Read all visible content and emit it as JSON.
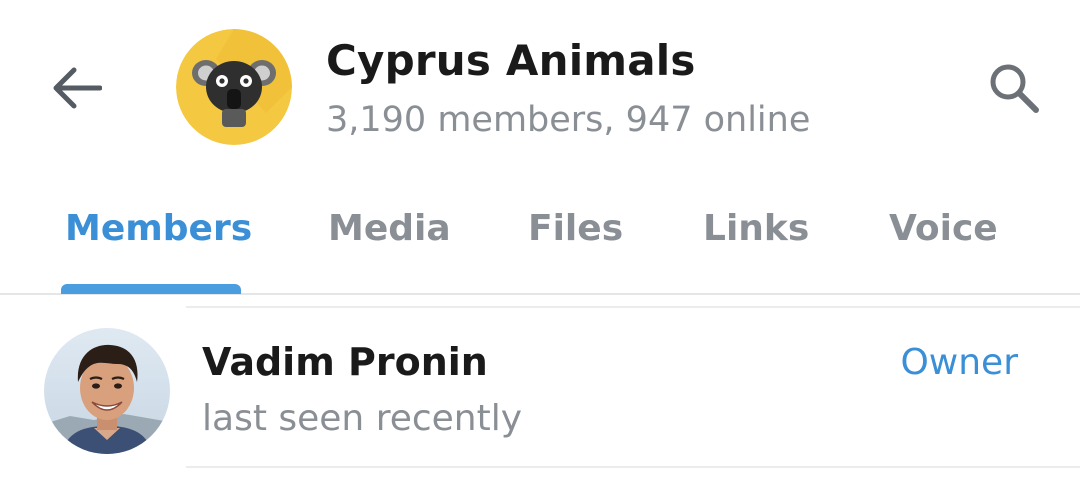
{
  "header": {
    "title": "Cyprus Animals",
    "subtitle": "3,190 members, 947 online",
    "back_icon": "arrow-left-icon",
    "search_icon": "magnifier-icon",
    "avatar_icon": "koala-icon",
    "avatar_color": "#F5C842"
  },
  "tabs": [
    {
      "label": "Members",
      "active": true
    },
    {
      "label": "Media",
      "active": false
    },
    {
      "label": "Files",
      "active": false
    },
    {
      "label": "Links",
      "active": false
    },
    {
      "label": "Voice",
      "active": false
    }
  ],
  "members": [
    {
      "name": "Vadim Pronin",
      "status": "last seen recently",
      "role": "Owner"
    }
  ],
  "colors": {
    "accent": "#3B8FD6",
    "muted_text": "#8A8F95",
    "primary_text": "#1A1A1A"
  }
}
